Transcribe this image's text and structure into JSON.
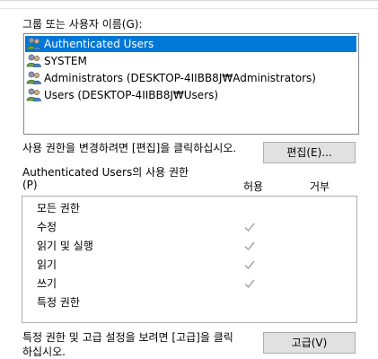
{
  "group_list": {
    "label": "그룹 또는 사용자 이름(G):",
    "items": [
      {
        "name": "Authenticated Users",
        "selected": true,
        "icon": "users-group-icon"
      },
      {
        "name": "SYSTEM",
        "selected": false,
        "icon": "users-group-icon"
      },
      {
        "name": "Administrators (DESKTOP-4IIBB8J₩Administrators)",
        "selected": false,
        "icon": "users-group-icon"
      },
      {
        "name": "Users (DESKTOP-4IIBB8J₩Users)",
        "selected": false,
        "icon": "users-group-icon"
      }
    ]
  },
  "edit_section": {
    "prompt": "사용 권한을 변경하려면 [편집]을 클릭하십시오.",
    "button_label": "편집(E)..."
  },
  "permissions": {
    "title": "Authenticated Users의 사용 권한",
    "title_suffix": "(P)",
    "allow_header": "허용",
    "deny_header": "거부",
    "rows": [
      {
        "name": "모든 권한",
        "allow": false,
        "deny": false
      },
      {
        "name": "수정",
        "allow": true,
        "deny": false
      },
      {
        "name": "읽기 및 실행",
        "allow": true,
        "deny": false
      },
      {
        "name": "읽기",
        "allow": true,
        "deny": false
      },
      {
        "name": "쓰기",
        "allow": true,
        "deny": false
      },
      {
        "name": "특정 권한",
        "allow": false,
        "deny": false
      }
    ]
  },
  "advanced_section": {
    "prompt_line1": "특정 권한 및 고급 설정을 보려면 [고급]을 클릭",
    "prompt_line2": "하십시오.",
    "button_label": "고급(V)"
  },
  "colors": {
    "selection": "#0078d7",
    "button_face": "#e1e1e1",
    "check_gray": "#a0a0a0"
  }
}
